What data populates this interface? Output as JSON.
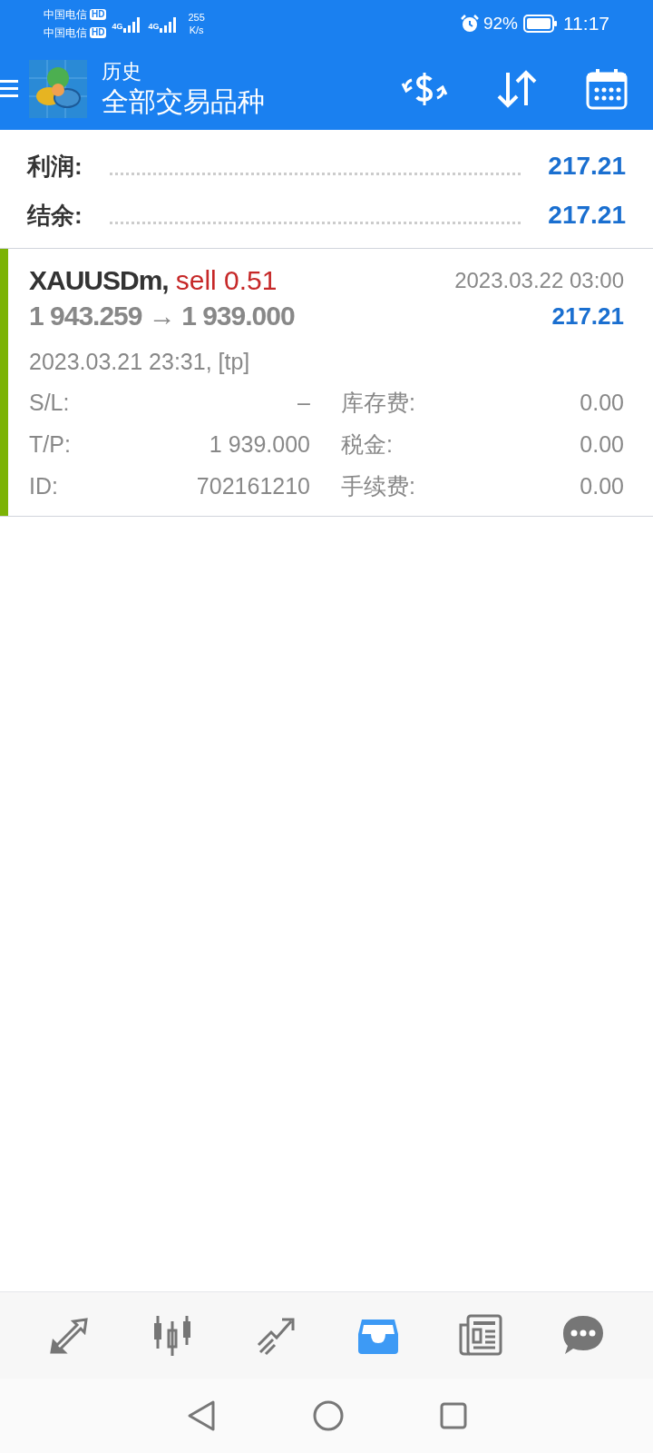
{
  "status_bar": {
    "carriers": [
      {
        "name": "中国电信",
        "badge": "HD",
        "network": "4G"
      },
      {
        "name": "中国电信",
        "badge": "HD",
        "network": "4G"
      }
    ],
    "speed_value": "255",
    "speed_unit": "K/s",
    "battery": "92%",
    "time": "11:17"
  },
  "header": {
    "title": "历史",
    "subtitle": "全部交易品种"
  },
  "summary": [
    {
      "label": "利润:",
      "value": "217.21"
    },
    {
      "label": "结余:",
      "value": "217.21"
    }
  ],
  "deals": [
    {
      "symbol": "XAUUSDm,",
      "side": "sell 0.51",
      "close_time": "2023.03.22 03:00",
      "prices": "1 943.259 → 1 939.000",
      "profit": "217.21",
      "open_time": "2023.03.21 23:31, [tp]",
      "details": [
        [
          "S/L:",
          "–",
          "库存费:",
          "0.00"
        ],
        [
          "T/P:",
          "1 939.000",
          "税金:",
          "0.00"
        ],
        [
          "ID:",
          "702161210",
          "手续费:",
          "0.00"
        ]
      ],
      "color": "#7cb305"
    }
  ],
  "nav_tabs": [
    {
      "kind": "trade",
      "selected": false
    },
    {
      "kind": "chart",
      "selected": false
    },
    {
      "kind": "signals",
      "selected": false
    },
    {
      "kind": "history",
      "selected": true
    },
    {
      "kind": "news",
      "selected": false
    },
    {
      "kind": "chat",
      "selected": false
    }
  ]
}
